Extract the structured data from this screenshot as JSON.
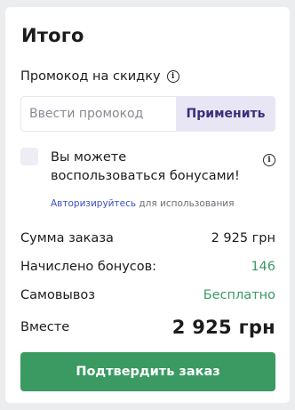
{
  "summary": {
    "title": "Итого",
    "promo": {
      "label": "Промокод на скидку",
      "info_icon": "info-icon",
      "input_placeholder": "Ввести промокод",
      "input_value": "",
      "apply_label": "Применить"
    },
    "bonus": {
      "checked": false,
      "text": "Вы можете воспользоваться бонусами!",
      "info_icon": "info-icon",
      "auth_link": "Авторизируйтесь",
      "auth_suffix": " для использования"
    },
    "rows": {
      "order_sum_label": "Сумма заказа",
      "order_sum_value": "2 925 грн",
      "bonus_label": "Начислено бонусов:",
      "bonus_value": "146",
      "pickup_label": "Самовывоз",
      "pickup_value": "Бесплатно",
      "total_label": "Вместе",
      "total_value": "2 925 грн"
    },
    "confirm_label": "Подтвердить заказ"
  },
  "colors": {
    "accent_green": "#3a9a62",
    "accent_purple": "#3b2f7a",
    "link_blue": "#3d4fc4",
    "page_background": "#ecedef"
  }
}
